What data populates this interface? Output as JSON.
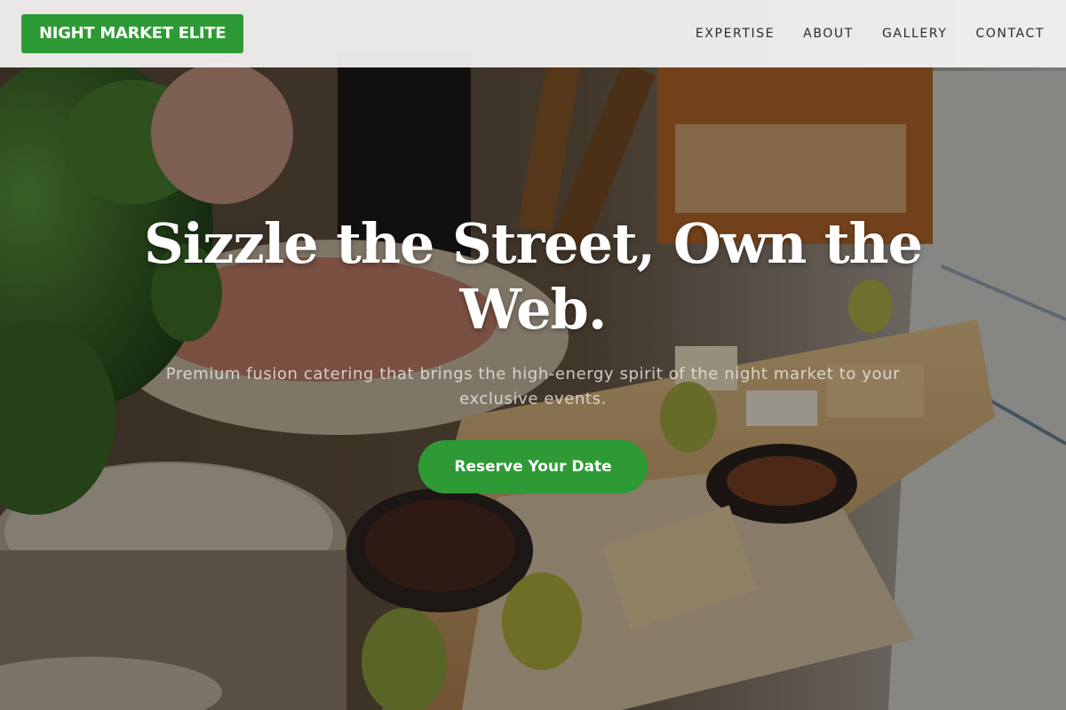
{
  "header": {
    "logo_text": "NIGHT MARKET ELITE",
    "nav": [
      {
        "label": "EXPERTISE"
      },
      {
        "label": "ABOUT"
      },
      {
        "label": "GALLERY"
      },
      {
        "label": "CONTACT"
      }
    ]
  },
  "hero": {
    "headline": "Sizzle the Street, Own the Web.",
    "subtitle": "Premium fusion catering that brings the high-energy spirit of the night market to your exclusive events.",
    "cta_label": "Reserve Your Date"
  },
  "colors": {
    "brand_green": "#2e9a35",
    "header_bg": "#f5f5f5",
    "nav_text": "#2b2b2b",
    "headline_text": "#ffffff"
  }
}
